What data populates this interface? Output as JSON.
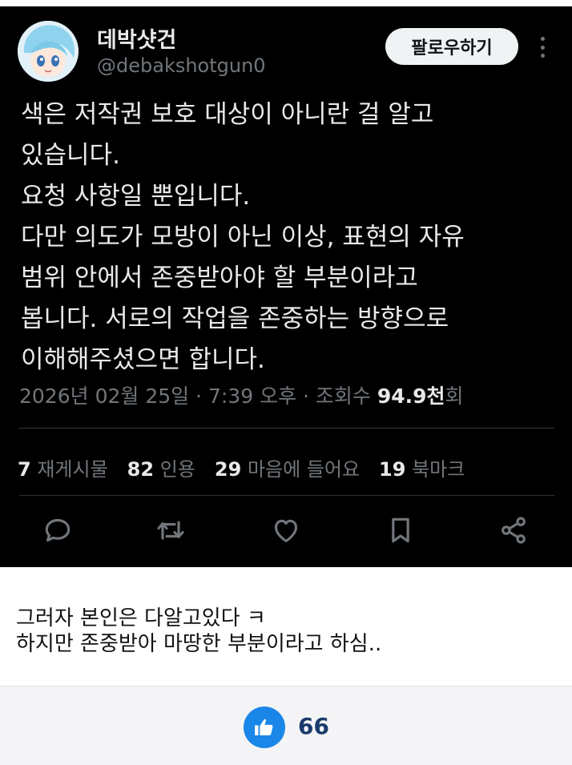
{
  "tweet": {
    "display_name": "데박샷건",
    "handle": "@debakshotgun0",
    "follow_label": "팔로우하기",
    "text_lines": [
      "색은 저작권 보호 대상이 아니란 걸 알고",
      "있습니다.",
      "요청 사항일 뿐입니다.",
      "다만 의도가 모방이 아닌 이상, 표현의 자유",
      "범위 안에서 존중받아야 할 부분이라고",
      "봅니다. 서로의 작업을 존중하는 방향으로",
      "이해해주셨으면 합니다."
    ],
    "timestamp": "2026년 02월 25일 · 7:39 오후 · 조회수 ",
    "views_value": "94.9천",
    "views_suffix": "회",
    "stats": {
      "reposts_count": "7",
      "reposts_label": "재게시물",
      "quotes_count": "82",
      "quotes_label": "인용",
      "likes_count": "29",
      "likes_label": "마음에 들어요",
      "bookmarks_count": "19",
      "bookmarks_label": "북마크"
    },
    "actions": [
      "reply-icon",
      "retweet-icon",
      "heart-icon",
      "bookmark-icon",
      "share-icon"
    ]
  },
  "comment": {
    "lines": [
      "그러자 본인은 다알고있다 ㅋ",
      "하지만 존중받아 마땅한 부분이라고 하심.."
    ]
  },
  "footer": {
    "like_count": "66",
    "like_icon": "thumbs-up-icon",
    "accent_color": "#1a86e8"
  }
}
